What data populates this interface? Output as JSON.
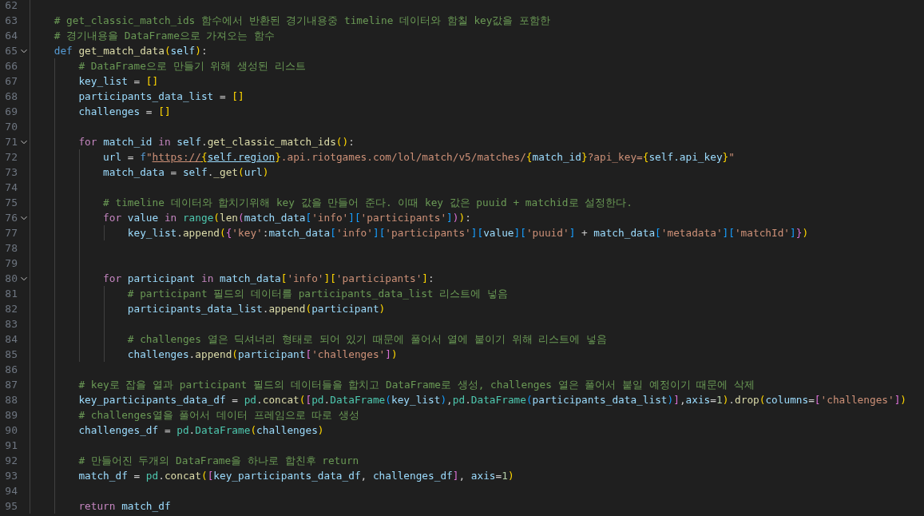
{
  "editor": {
    "lines": [
      {
        "number": "62"
      },
      {
        "number": "63",
        "tokens": [
          {
            "kind": "cmt",
            "text": "    # get_classic_match_ids 함수에서 반환된 경기내용중 timeline 데이터와 함칠 key값을 포함한"
          }
        ]
      },
      {
        "number": "64",
        "tokens": [
          {
            "kind": "cmt",
            "text": "    # 경기내용을 DataFrame으로 가져오는 함수"
          }
        ]
      },
      {
        "number": "65",
        "fold": {
          "expanded": true
        },
        "tokens": [
          {
            "kind": "kw",
            "text": "    def "
          },
          {
            "kind": "fn",
            "text": "get_match_data"
          },
          {
            "kind": "b1",
            "text": "("
          },
          {
            "kind": "var",
            "text": "self"
          },
          {
            "kind": "b1",
            "text": ")"
          },
          {
            "kind": "op",
            "text": ":"
          }
        ]
      },
      {
        "number": "66",
        "tokens": [
          {
            "kind": "cmt",
            "text": "        # DataFrame으로 만들기 위해 생성된 리스트"
          }
        ]
      },
      {
        "number": "67",
        "tokens": [
          {
            "kind": "var",
            "text": "        key_list"
          },
          {
            "kind": "op",
            "text": " = "
          },
          {
            "kind": "b1",
            "text": "[]"
          }
        ]
      },
      {
        "number": "68",
        "tokens": [
          {
            "kind": "var",
            "text": "        participants_data_list"
          },
          {
            "kind": "op",
            "text": " = "
          },
          {
            "kind": "b1",
            "text": "[]"
          }
        ]
      },
      {
        "number": "69",
        "tokens": [
          {
            "kind": "var",
            "text": "        challenges"
          },
          {
            "kind": "op",
            "text": " = "
          },
          {
            "kind": "b1",
            "text": "[]"
          }
        ]
      },
      {
        "number": "70"
      },
      {
        "number": "71",
        "fold": {
          "expanded": true
        },
        "tokens": [
          {
            "kind": "ctrl",
            "text": "        for "
          },
          {
            "kind": "var",
            "text": "match_id "
          },
          {
            "kind": "ctrl",
            "text": "in "
          },
          {
            "kind": "var",
            "text": "self"
          },
          {
            "kind": "op",
            "text": "."
          },
          {
            "kind": "fn",
            "text": "get_classic_match_ids"
          },
          {
            "kind": "b1",
            "text": "()"
          },
          {
            "kind": "op",
            "text": ":"
          }
        ]
      },
      {
        "number": "72",
        "tokens": [
          {
            "kind": "var",
            "text": "            url"
          },
          {
            "kind": "op",
            "text": " = "
          },
          {
            "kind": "kw",
            "text": "f"
          },
          {
            "kind": "str",
            "text": "\""
          },
          {
            "kind": "link_str",
            "text": "https://"
          },
          {
            "kind": "link_b1",
            "text": "{"
          },
          {
            "kind": "link_var",
            "text": "self.region"
          },
          {
            "kind": "b1",
            "text": "}"
          },
          {
            "kind": "str",
            "text": ".api.riotgames.com/lol/match/v5/matches/"
          },
          {
            "kind": "b1",
            "text": "{"
          },
          {
            "kind": "var",
            "text": "match_id"
          },
          {
            "kind": "b1",
            "text": "}"
          },
          {
            "kind": "str",
            "text": "?api_key="
          },
          {
            "kind": "b1",
            "text": "{"
          },
          {
            "kind": "var",
            "text": "self.api_key"
          },
          {
            "kind": "b1",
            "text": "}"
          },
          {
            "kind": "str",
            "text": "\""
          }
        ]
      },
      {
        "number": "73",
        "tokens": [
          {
            "kind": "var",
            "text": "            match_data"
          },
          {
            "kind": "op",
            "text": " = "
          },
          {
            "kind": "var",
            "text": "self"
          },
          {
            "kind": "op",
            "text": "."
          },
          {
            "kind": "fn",
            "text": "_get"
          },
          {
            "kind": "b1",
            "text": "("
          },
          {
            "kind": "var",
            "text": "url"
          },
          {
            "kind": "b1",
            "text": ")"
          }
        ]
      },
      {
        "number": "74"
      },
      {
        "number": "75",
        "tokens": [
          {
            "kind": "cmt",
            "text": "            # timeline 데이터와 합치기위해 key 값을 만들어 준다. 이때 key 값은 puuid + matchid로 설정한다."
          }
        ]
      },
      {
        "number": "76",
        "fold": {
          "expanded": true
        },
        "tokens": [
          {
            "kind": "ctrl",
            "text": "            for "
          },
          {
            "kind": "var",
            "text": "value "
          },
          {
            "kind": "ctrl",
            "text": "in "
          },
          {
            "kind": "cls",
            "text": "range"
          },
          {
            "kind": "b1",
            "text": "("
          },
          {
            "kind": "fn",
            "text": "len"
          },
          {
            "kind": "b2",
            "text": "("
          },
          {
            "kind": "var",
            "text": "match_data"
          },
          {
            "kind": "b3",
            "text": "["
          },
          {
            "kind": "str",
            "text": "'info'"
          },
          {
            "kind": "b3",
            "text": "]["
          },
          {
            "kind": "str",
            "text": "'participants'"
          },
          {
            "kind": "b3",
            "text": "]"
          },
          {
            "kind": "b2",
            "text": ")"
          },
          {
            "kind": "b1",
            "text": ")"
          },
          {
            "kind": "op",
            "text": ":"
          }
        ]
      },
      {
        "number": "77",
        "tokens": [
          {
            "kind": "var",
            "text": "                key_list"
          },
          {
            "kind": "op",
            "text": "."
          },
          {
            "kind": "fn",
            "text": "append"
          },
          {
            "kind": "b1",
            "text": "("
          },
          {
            "kind": "b2",
            "text": "{"
          },
          {
            "kind": "str",
            "text": "'key'"
          },
          {
            "kind": "op",
            "text": ":"
          },
          {
            "kind": "var",
            "text": "match_data"
          },
          {
            "kind": "b3",
            "text": "["
          },
          {
            "kind": "str",
            "text": "'info'"
          },
          {
            "kind": "b3",
            "text": "]["
          },
          {
            "kind": "str",
            "text": "'participants'"
          },
          {
            "kind": "b3",
            "text": "]["
          },
          {
            "kind": "var",
            "text": "value"
          },
          {
            "kind": "b3",
            "text": "]["
          },
          {
            "kind": "str",
            "text": "'puuid'"
          },
          {
            "kind": "b3",
            "text": "]"
          },
          {
            "kind": "op",
            "text": " + "
          },
          {
            "kind": "var",
            "text": "match_data"
          },
          {
            "kind": "b3",
            "text": "["
          },
          {
            "kind": "str",
            "text": "'metadata'"
          },
          {
            "kind": "b3",
            "text": "]["
          },
          {
            "kind": "str",
            "text": "'matchId'"
          },
          {
            "kind": "b3",
            "text": "]"
          },
          {
            "kind": "b2",
            "text": "}"
          },
          {
            "kind": "b1",
            "text": ")"
          }
        ]
      },
      {
        "number": "78"
      },
      {
        "number": "79"
      },
      {
        "number": "80",
        "fold": {
          "expanded": true
        },
        "tokens": [
          {
            "kind": "ctrl",
            "text": "            for "
          },
          {
            "kind": "var",
            "text": "participant "
          },
          {
            "kind": "ctrl",
            "text": "in "
          },
          {
            "kind": "var",
            "text": "match_data"
          },
          {
            "kind": "b1",
            "text": "["
          },
          {
            "kind": "str",
            "text": "'info'"
          },
          {
            "kind": "b1",
            "text": "]["
          },
          {
            "kind": "str",
            "text": "'participants'"
          },
          {
            "kind": "b1",
            "text": "]"
          },
          {
            "kind": "op",
            "text": ":"
          }
        ]
      },
      {
        "number": "81",
        "tokens": [
          {
            "kind": "cmt",
            "text": "                # participant 필드의 데이터를 participants_data_list 리스트에 넣음"
          }
        ]
      },
      {
        "number": "82",
        "tokens": [
          {
            "kind": "var",
            "text": "                participants_data_list"
          },
          {
            "kind": "op",
            "text": "."
          },
          {
            "kind": "fn",
            "text": "append"
          },
          {
            "kind": "b1",
            "text": "("
          },
          {
            "kind": "var",
            "text": "participant"
          },
          {
            "kind": "b1",
            "text": ")"
          }
        ]
      },
      {
        "number": "83"
      },
      {
        "number": "84",
        "tokens": [
          {
            "kind": "cmt",
            "text": "                # challenges 열은 딕셔너리 형태로 되어 있기 때문에 풀어서 열에 붙이기 위해 리스트에 넣음"
          }
        ]
      },
      {
        "number": "85",
        "tokens": [
          {
            "kind": "var",
            "text": "                challenges"
          },
          {
            "kind": "op",
            "text": "."
          },
          {
            "kind": "fn",
            "text": "append"
          },
          {
            "kind": "b1",
            "text": "("
          },
          {
            "kind": "var",
            "text": "participant"
          },
          {
            "kind": "b2",
            "text": "["
          },
          {
            "kind": "str",
            "text": "'challenges'"
          },
          {
            "kind": "b2",
            "text": "]"
          },
          {
            "kind": "b1",
            "text": ")"
          }
        ]
      },
      {
        "number": "86"
      },
      {
        "number": "87",
        "tokens": [
          {
            "kind": "cmt",
            "text": "        # key로 잡을 열과 participant 필드의 데이터들을 합치고 DataFrame로 생성, challenges 열은 풀어서 붙일 예정이기 때문에 삭제"
          }
        ]
      },
      {
        "number": "88",
        "tokens": [
          {
            "kind": "var",
            "text": "        key_participants_data_df"
          },
          {
            "kind": "op",
            "text": " = "
          },
          {
            "kind": "cls",
            "text": "pd"
          },
          {
            "kind": "op",
            "text": "."
          },
          {
            "kind": "fn",
            "text": "concat"
          },
          {
            "kind": "b1",
            "text": "("
          },
          {
            "kind": "b2",
            "text": "["
          },
          {
            "kind": "cls",
            "text": "pd"
          },
          {
            "kind": "op",
            "text": "."
          },
          {
            "kind": "cls",
            "text": "DataFrame"
          },
          {
            "kind": "b3",
            "text": "("
          },
          {
            "kind": "var",
            "text": "key_list"
          },
          {
            "kind": "b3",
            "text": ")"
          },
          {
            "kind": "op",
            "text": ","
          },
          {
            "kind": "cls",
            "text": "pd"
          },
          {
            "kind": "op",
            "text": "."
          },
          {
            "kind": "cls",
            "text": "DataFrame"
          },
          {
            "kind": "b3",
            "text": "("
          },
          {
            "kind": "var",
            "text": "participants_data_list"
          },
          {
            "kind": "b3",
            "text": ")"
          },
          {
            "kind": "b2",
            "text": "]"
          },
          {
            "kind": "op",
            "text": ","
          },
          {
            "kind": "var",
            "text": "axis"
          },
          {
            "kind": "op",
            "text": "="
          },
          {
            "kind": "num",
            "text": "1"
          },
          {
            "kind": "b1",
            "text": ")"
          },
          {
            "kind": "op",
            "text": "."
          },
          {
            "kind": "fn",
            "text": "drop"
          },
          {
            "kind": "b1",
            "text": "("
          },
          {
            "kind": "var",
            "text": "columns"
          },
          {
            "kind": "op",
            "text": "="
          },
          {
            "kind": "b2",
            "text": "["
          },
          {
            "kind": "str",
            "text": "'challenges'"
          },
          {
            "kind": "b2",
            "text": "]"
          },
          {
            "kind": "b1",
            "text": ")"
          }
        ]
      },
      {
        "number": "89",
        "tokens": [
          {
            "kind": "cmt",
            "text": "        # challenges열을 풀어서 데이터 프레임으로 따로 생성"
          }
        ]
      },
      {
        "number": "90",
        "tokens": [
          {
            "kind": "var",
            "text": "        challenges_df"
          },
          {
            "kind": "op",
            "text": " = "
          },
          {
            "kind": "cls",
            "text": "pd"
          },
          {
            "kind": "op",
            "text": "."
          },
          {
            "kind": "cls",
            "text": "DataFrame"
          },
          {
            "kind": "b1",
            "text": "("
          },
          {
            "kind": "var",
            "text": "challenges"
          },
          {
            "kind": "b1",
            "text": ")"
          }
        ]
      },
      {
        "number": "91"
      },
      {
        "number": "92",
        "tokens": [
          {
            "kind": "cmt",
            "text": "        # 만들어진 두개의 DataFrame을 하나로 합친후 return"
          }
        ]
      },
      {
        "number": "93",
        "tokens": [
          {
            "kind": "var",
            "text": "        match_df"
          },
          {
            "kind": "op",
            "text": " = "
          },
          {
            "kind": "cls",
            "text": "pd"
          },
          {
            "kind": "op",
            "text": "."
          },
          {
            "kind": "fn",
            "text": "concat"
          },
          {
            "kind": "b1",
            "text": "("
          },
          {
            "kind": "b2",
            "text": "["
          },
          {
            "kind": "var",
            "text": "key_participants_data_df"
          },
          {
            "kind": "op",
            "text": ", "
          },
          {
            "kind": "var",
            "text": "challenges_df"
          },
          {
            "kind": "b2",
            "text": "]"
          },
          {
            "kind": "op",
            "text": ", "
          },
          {
            "kind": "var",
            "text": "axis"
          },
          {
            "kind": "op",
            "text": "="
          },
          {
            "kind": "num",
            "text": "1"
          },
          {
            "kind": "b1",
            "text": ")"
          }
        ]
      },
      {
        "number": "94"
      },
      {
        "number": "95",
        "tokens": [
          {
            "kind": "ctrl",
            "text": "        return "
          },
          {
            "kind": "var",
            "text": "match_df"
          }
        ]
      }
    ]
  }
}
